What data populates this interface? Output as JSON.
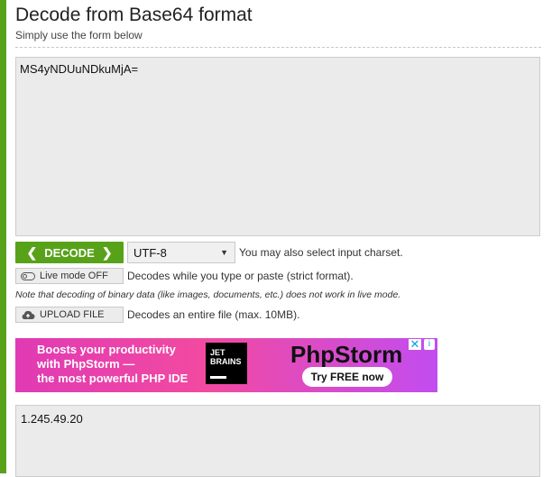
{
  "header": {
    "title": "Decode from Base64 format",
    "subtitle": "Simply use the form below"
  },
  "input": {
    "value": "MS4yNDUuNDkuMjA="
  },
  "controls": {
    "decode_label": "DECODE",
    "charset_value": "UTF-8",
    "charset_hint": "You may also select input charset.",
    "live_mode_label": "Live mode OFF",
    "live_mode_hint": "Decodes while you type or paste (strict format).",
    "binary_note": "Note that decoding of binary data (like images, documents, etc.) does not work in live mode.",
    "upload_label": "UPLOAD FILE",
    "upload_hint": "Decodes an entire file (max. 10MB)."
  },
  "ad": {
    "line1": "Boosts your productivity",
    "line2": "with PhpStorm —",
    "line3": "the most powerful PHP IDE",
    "logo_line1": "JET",
    "logo_line2": "BRAINS",
    "brand": "PhpStorm",
    "cta": "Try FREE now",
    "info_icon": "i",
    "close_icon": "✕"
  },
  "output": {
    "value": "1.245.49.20"
  },
  "colors": {
    "accent": "#58a21a",
    "field_bg": "#ebebeb"
  },
  "icons": {
    "decode_left": "chevron-left-icon",
    "decode_right": "chevron-right-icon",
    "dropdown": "triangle-down-icon",
    "toggle": "toggle-off-icon",
    "upload": "cloud-upload-icon"
  }
}
